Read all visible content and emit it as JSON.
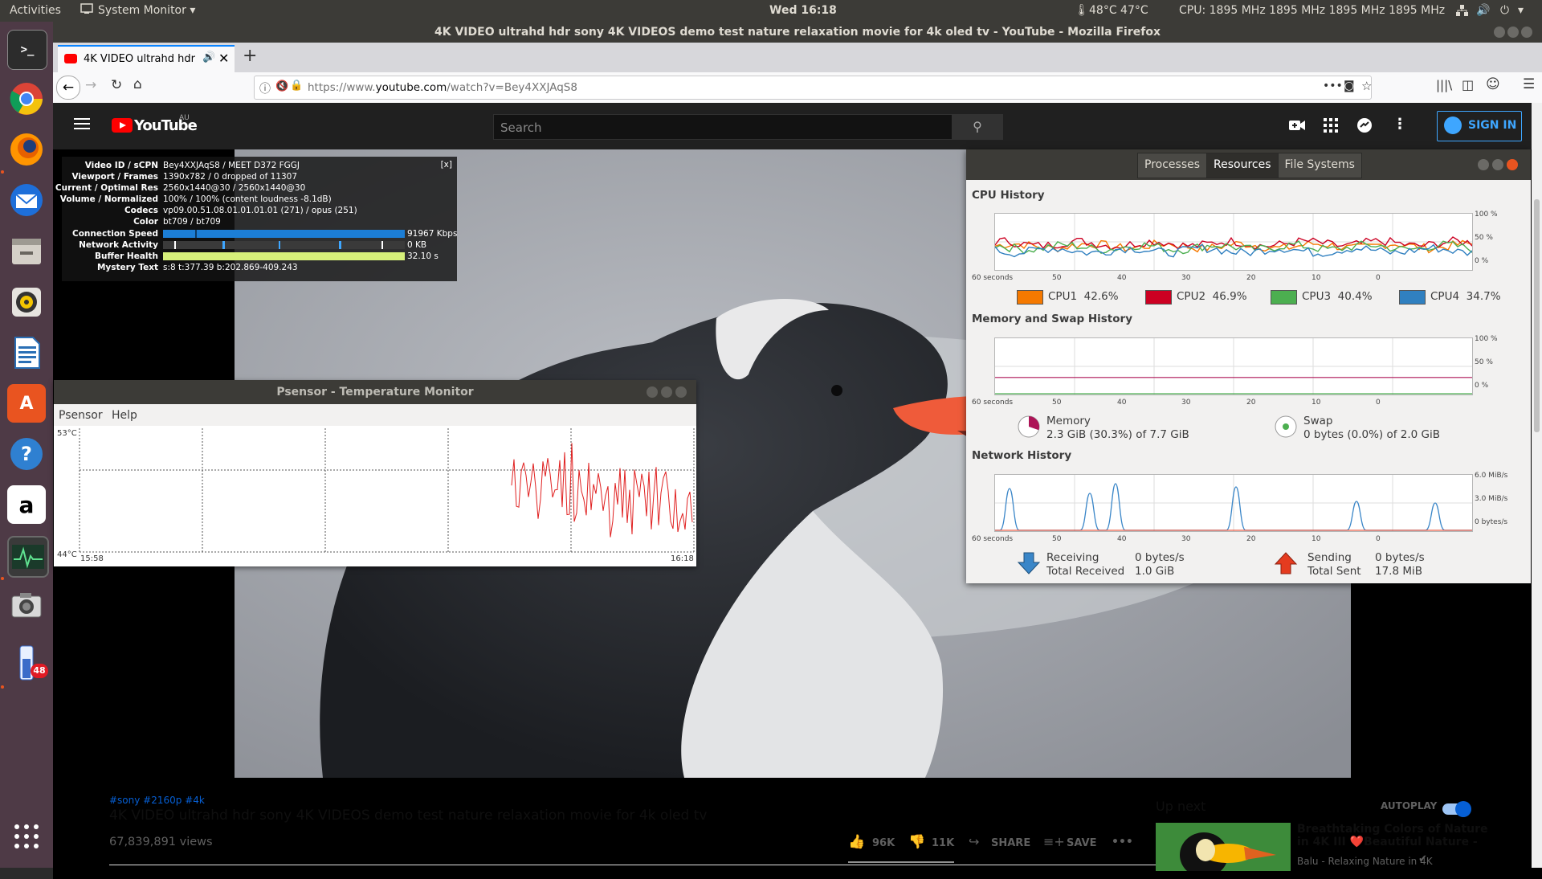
{
  "topbar": {
    "activities": "Activities",
    "app_menu": "System Monitor",
    "clock": "Wed 16:18",
    "temps": "48°C 47°C",
    "cpu_freq": "CPU: 1895 MHz 1895 MHz 1895 MHz 1895 MHz"
  },
  "launcher": {
    "notification_badge": "48"
  },
  "firefox": {
    "window_title": "4K VIDEO ultrahd hdr sony 4K VIDEOS demo test nature relaxation movie for 4k oled tv - YouTube - Mozilla Firefox",
    "tab_title": "4K VIDEO ultrahd hdr",
    "url_prefix": "https://www.",
    "url_domain": "youtube.com",
    "url_path": "/watch?v=Bey4XXJAqS8"
  },
  "youtube": {
    "logo_text": "YouTube",
    "region": "AU",
    "search_placeholder": "Search",
    "sign_in": "SIGN IN",
    "hashtags": "#sony #2160p #4k",
    "video_title": "4K VIDEO ultrahd hdr sony 4K VIDEOS demo test nature relaxation movie for 4k oled tv",
    "views": "67,839,891 views",
    "likes": "96K",
    "dislikes": "11K",
    "share": "SHARE",
    "save": "SAVE",
    "more": "•••",
    "up_next": "Up next",
    "autoplay": "AUTOPLAY",
    "next_title_line1": "Breathtaking Colors of Nature",
    "next_title_line2": "in 4K III ❤️Beautiful Nature -",
    "next_channel": "Balu - Relaxing Nature in 4K"
  },
  "stats": {
    "close": "[x]",
    "rows": [
      {
        "k": "Video ID / sCPN",
        "v": "Bey4XXJAqS8 / MEET D372 FGGJ"
      },
      {
        "k": "Viewport / Frames",
        "v": "1390x782 / 0 dropped of 11307"
      },
      {
        "k": "Current / Optimal Res",
        "v": "2560x1440@30 / 2560x1440@30"
      },
      {
        "k": "Volume / Normalized",
        "v": "100% / 100% (content loudness -8.1dB)"
      },
      {
        "k": "Codecs",
        "v": "vp09.00.51.08.01.01.01.01 (271) / opus (251)"
      },
      {
        "k": "Color",
        "v": "bt709 / bt709"
      },
      {
        "k": "Connection Speed",
        "v": "91967 Kbps"
      },
      {
        "k": "Network Activity",
        "v": "0 KB"
      },
      {
        "k": "Buffer Health",
        "v": "32.10 s"
      },
      {
        "k": "Mystery Text",
        "v": "s:8 t:377.39 b:202.869-409.243"
      }
    ]
  },
  "psensor": {
    "title": "Psensor - Temperature Monitor",
    "menu_psensor": "Psensor",
    "menu_help": "Help",
    "y_max": "53°C",
    "y_min": "44°C",
    "x_start": "15:58",
    "x_end": "16:18"
  },
  "sysmon": {
    "tabs": [
      "Processes",
      "Resources",
      "File Systems"
    ],
    "cpu_heading": "CPU History",
    "mem_heading": "Memory and Swap History",
    "net_heading": "Network History",
    "x_ticks": [
      "60 seconds",
      "50",
      "40",
      "30",
      "20",
      "10",
      "0"
    ],
    "pct_ticks": [
      "100 %",
      "50 %",
      "0 %"
    ],
    "net_ticks": [
      "6.0 MiB/s",
      "3.0 MiB/s",
      "0 bytes/s"
    ],
    "cpus": [
      {
        "label": "CPU1",
        "value": "42.6%",
        "color": "#f57900"
      },
      {
        "label": "CPU2",
        "value": "46.9%",
        "color": "#cc0022"
      },
      {
        "label": "CPU3",
        "value": "40.4%",
        "color": "#4caf50"
      },
      {
        "label": "CPU4",
        "value": "34.7%",
        "color": "#3080c0"
      }
    ],
    "memory_label": "Memory",
    "memory_value": "2.3 GiB (30.3%) of 7.7 GiB",
    "memory_fraction": 0.303,
    "swap_label": "Swap",
    "swap_value": "0 bytes (0.0%) of 2.0 GiB",
    "recv_label": "Receiving",
    "recv_rate": "0 bytes/s",
    "recv_total_label": "Total Received",
    "recv_total": "1.0 GiB",
    "send_label": "Sending",
    "send_rate": "0 bytes/s",
    "send_total_label": "Total Sent",
    "send_total": "17.8 MiB"
  }
}
